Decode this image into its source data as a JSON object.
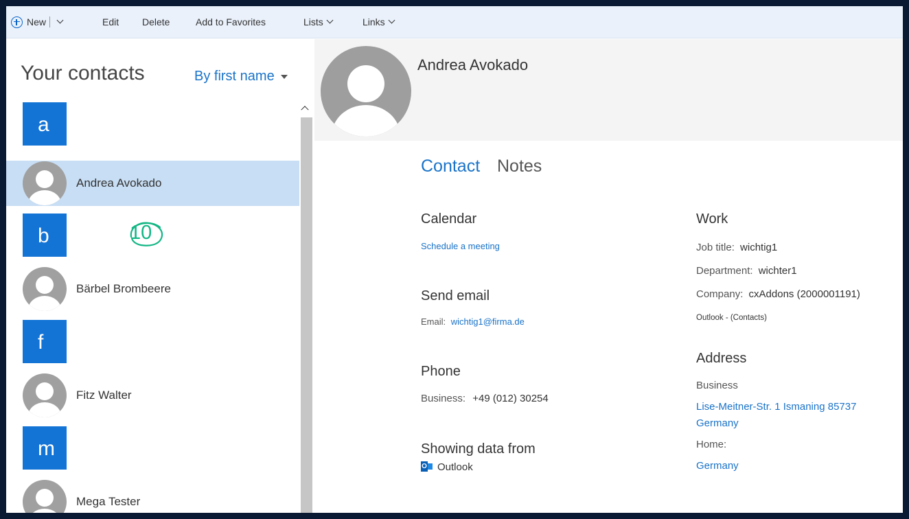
{
  "toolbar": {
    "new_label": "New",
    "edit_label": "Edit",
    "delete_label": "Delete",
    "favorites_label": "Add to Favorites",
    "lists_label": "Lists",
    "links_label": "Links"
  },
  "sidebar": {
    "title": "Your contacts",
    "sort_label": "By first name",
    "groups": [
      {
        "letter": "a",
        "contacts": [
          "Andrea Avokado"
        ]
      },
      {
        "letter": "b",
        "contacts": [
          "Bärbel Brombeere"
        ]
      },
      {
        "letter": "f",
        "contacts": [
          "Fitz Walter"
        ]
      },
      {
        "letter": "m",
        "contacts": [
          "Mega Tester"
        ]
      }
    ],
    "selected_contact": "Andrea Avokado",
    "badge": "10"
  },
  "contact": {
    "name": "Andrea Avokado",
    "tabs": [
      {
        "label": "Contact",
        "active": true
      },
      {
        "label": "Notes",
        "active": false
      }
    ],
    "calendar": {
      "title": "Calendar",
      "action": "Schedule a meeting"
    },
    "email": {
      "title": "Send email",
      "label": "Email:",
      "value": "wichtig1@firma.de"
    },
    "phone": {
      "title": "Phone",
      "label": "Business:",
      "value": "+49 (012) 30254"
    },
    "source": {
      "title": "Showing data from",
      "value": "Outlook"
    },
    "work": {
      "title": "Work",
      "job_label": "Job title:",
      "job_value": "wichtig1",
      "dept_label": "Department:",
      "dept_value": "wichter1",
      "company_label": "Company:",
      "company_value": "cxAddons (2000001191)",
      "source": "Outlook - (Contacts)"
    },
    "address": {
      "title": "Address",
      "business_label": "Business",
      "business_line1": "Lise-Meitner-Str. 1 Ismaning 85737",
      "business_line2": "Germany",
      "home_label": "Home:",
      "home_value": "Germany"
    }
  },
  "colors": {
    "accent": "#1a73c8",
    "letter_tile": "#1374d6",
    "selected_row": "#c8def4",
    "badge": "#12b684"
  }
}
